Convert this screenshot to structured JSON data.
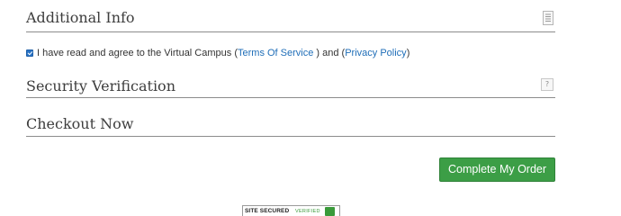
{
  "sections": {
    "additional_info": {
      "title": "Additional Info",
      "icon": "document-icon"
    },
    "security": {
      "title": "Security Verification",
      "help_label": "?"
    },
    "checkout": {
      "title": "Checkout Now"
    }
  },
  "agreement": {
    "checked": true,
    "text_before": "I have read and agree to the Virtual Campus (",
    "terms_link": "Terms Of Service",
    "text_middle": " ) and (",
    "privacy_link": "Privacy Policy",
    "text_after": ")"
  },
  "actions": {
    "complete_order_label": "Complete My Order"
  },
  "seal": {
    "left_text": "SITE SECURED",
    "right_text": "VERIFIED"
  },
  "colors": {
    "link": "#1f6eb8",
    "button_green": "#3c9e46",
    "checkbox_blue": "#2a73c5",
    "rule": "#8c8c8c"
  }
}
